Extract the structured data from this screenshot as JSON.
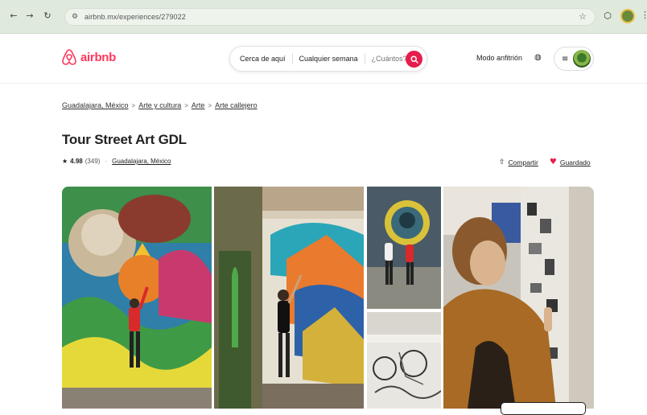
{
  "browser": {
    "url": "airbnb.mx/experiences/279022"
  },
  "header": {
    "logo_text": "airbnb",
    "search": {
      "where": "Cerca de aquí",
      "when": "Cualquier semana",
      "who": "¿Cuántos?"
    },
    "host_link": "Modo anfitrión"
  },
  "breadcrumb": [
    "Guadalajara, México",
    "Arte y cultura",
    "Arte",
    "Arte callejero"
  ],
  "listing": {
    "title": "Tour Street Art GDL",
    "rating": "4.98",
    "reviews": "(349)",
    "location": "Guadalajara, México",
    "share_label": "Compartir",
    "save_label": "Guardado"
  },
  "colors": {
    "brand": "#ff385c",
    "search_button": "#e61e4d",
    "browser_chrome": "#dfe9dc"
  }
}
